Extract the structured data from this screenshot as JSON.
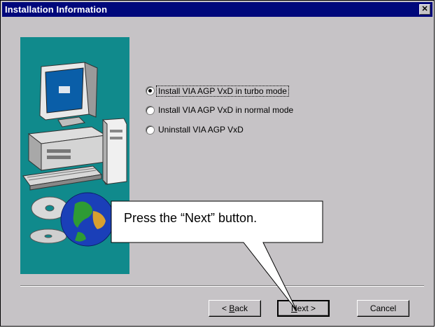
{
  "window": {
    "title": "Installation Information",
    "close_glyph": "✕"
  },
  "options": [
    {
      "label": "Install VIA AGP VxD in turbo mode",
      "selected": true
    },
    {
      "label": "Install VIA AGP VxD in normal mode",
      "selected": false
    },
    {
      "label": "Uninstall VIA AGP VxD",
      "selected": false
    }
  ],
  "buttons": {
    "back": {
      "pre": "< ",
      "accel": "B",
      "post": "ack"
    },
    "next": {
      "pre": "",
      "accel": "N",
      "post": "ext >"
    },
    "cancel": {
      "label": "Cancel"
    }
  },
  "callout": {
    "text": "Press the “Next” button."
  },
  "illustration": {
    "panel_color": "#108a8c",
    "icons": [
      "computer-icon",
      "cd-icon",
      "globe-icon"
    ]
  }
}
